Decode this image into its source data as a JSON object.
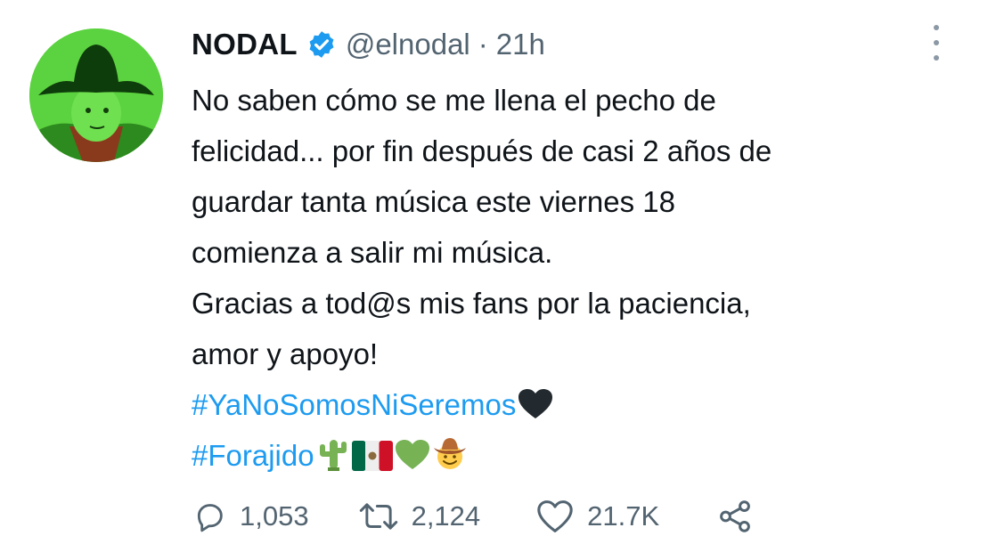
{
  "tweet": {
    "display_name": "NODAL",
    "handle": "@elnodal",
    "separator": "·",
    "time": "21h",
    "verified": true,
    "avatar_icon": "cowboy-child-avatar",
    "body_lines": [
      "No saben cómo se me llena el pecho de",
      "felicidad... por fin después de casi 2 años de",
      "guardar tanta música este viernes 18",
      "comienza a salir mi música.",
      "Gracias a tod@s mis fans por la paciencia,",
      "amor y apoyo!"
    ],
    "hashtags": [
      {
        "text": "#YaNoSomosNiSeremos",
        "emojis": [
          "black-heart-emoji"
        ]
      },
      {
        "text": "#Forajido",
        "emojis": [
          "cactus-emoji",
          "mexico-flag-emoji",
          "green-heart-emoji",
          "cowboy-face-emoji"
        ]
      }
    ]
  },
  "actions": {
    "replies": "1,053",
    "retweets": "2,124",
    "likes": "21.7K",
    "share_icon": "share-icon"
  },
  "colors": {
    "link": "#1d9bf0",
    "muted": "#536471",
    "text": "#0f1419",
    "verified": "#1d9bf0"
  }
}
